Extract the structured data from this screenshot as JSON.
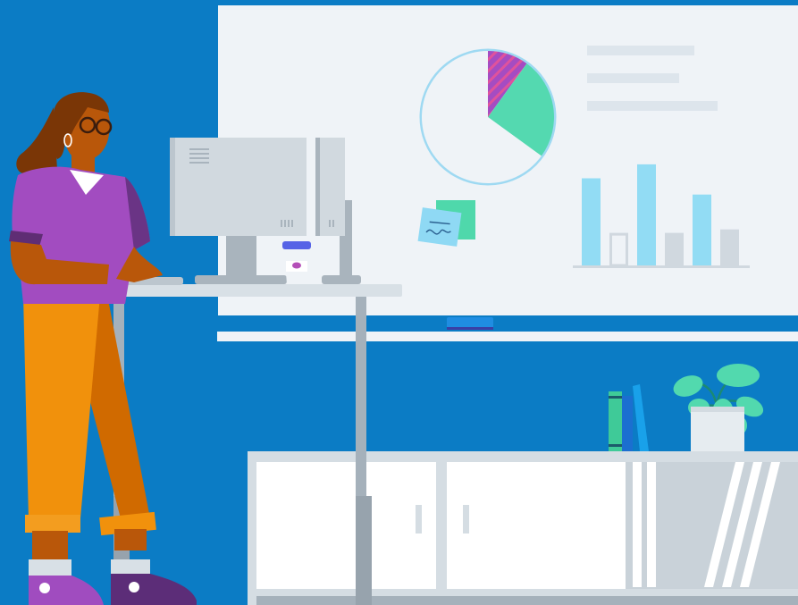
{
  "colors": {
    "background": "#0b7cc5",
    "whiteboard": "#eff3f7",
    "whiteboard_line": "#dde5ec",
    "pie_outline": "#9ed9f2",
    "pie_green": "#54d9b0",
    "pie_purple": "#a54cc2",
    "pie_stripe": "#e0529c",
    "bar_blue": "#92dcf4",
    "bar_gray": "#d0d8df",
    "sticky_green": "#4fd8ab",
    "sticky_blue": "#8fd9f4",
    "marker": "#1f8de2",
    "desk": "#d8e0e6",
    "desk_leg": "#a5b1bb",
    "monitor": "#d1d9df",
    "monitor_stand": "#a9b4bd",
    "cup_lid": "#5663e6",
    "cup_dot": "#b44fb8",
    "cabinet": "#ffffff",
    "cabinet_trim": "#d5dde3",
    "book_green": "#3fca98",
    "book_blue": "#19a1ea",
    "plant": "#52d9ae",
    "pot": "#e6ecf0",
    "skin": "#b9570a",
    "hair": "#7a3606",
    "shirt": "#a24cc0",
    "shirt_dark": "#5f2d74",
    "pants": "#f1910c",
    "pants_shadow": "#d06a00",
    "sock": "#d8e0e6",
    "shoe": "#a04cbf",
    "glasses": "#3b1d0e"
  },
  "icons": {
    "pie": "pie-chart-icon",
    "bars": "bar-chart-icon",
    "note": "sticky-note-icon",
    "plant": "potted-plant-icon"
  },
  "chart_data": {
    "type": "pie",
    "slices": [
      {
        "value": 0.65,
        "color": "#eff3f7"
      },
      {
        "value": 0.25,
        "color": "#54d9b0"
      },
      {
        "value": 0.1,
        "color": "#a54cc2"
      }
    ]
  },
  "bar_illustration": {
    "values": [
      0.75,
      0.28,
      0.87,
      0.28,
      0.61,
      0.31
    ],
    "styles": [
      "blue",
      "outline",
      "blue",
      "gray",
      "blue",
      "gray"
    ]
  }
}
